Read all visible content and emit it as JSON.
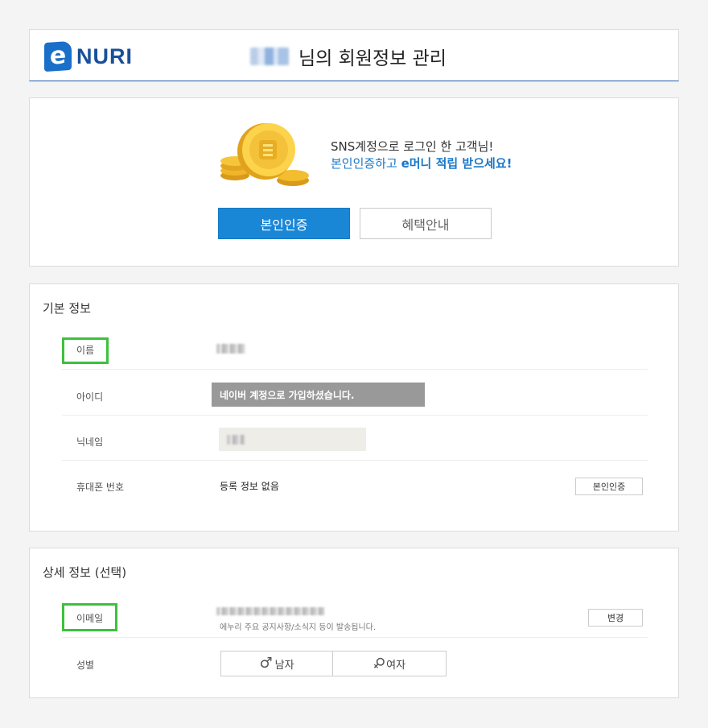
{
  "header": {
    "logo_letter": "e",
    "logo_text": "NURI",
    "title": "님의 회원정보 관리"
  },
  "promo": {
    "line1": "SNS계정으로 로그인 한 고객님!",
    "line2_prefix": "본인인증하고 ",
    "line2_bold": "e머니 적립 받으세요!",
    "verify_button": "본인인증",
    "benefit_button": "혜택안내"
  },
  "basic_info": {
    "title": "기본 정보",
    "name_label": "이름",
    "id_label": "아이디",
    "id_value": "네이버 계정으로 가입하셨습니다.",
    "nickname_label": "닉네임",
    "phone_label": "휴대폰 번호",
    "phone_value": "등록 정보 없음",
    "phone_button": "본인인증"
  },
  "detail_info": {
    "title": "상세 정보 (선택)",
    "email_label": "이메일",
    "email_note": "에누리 주요 공지사항/소식지 등이 발송됩니다.",
    "email_button": "변경",
    "gender_label": "성별",
    "gender_male": "남자",
    "gender_female": "여자"
  },
  "colors": {
    "accent": "#1a86d6",
    "highlight": "#3cc13c",
    "header_rule": "#1f5ea8"
  }
}
